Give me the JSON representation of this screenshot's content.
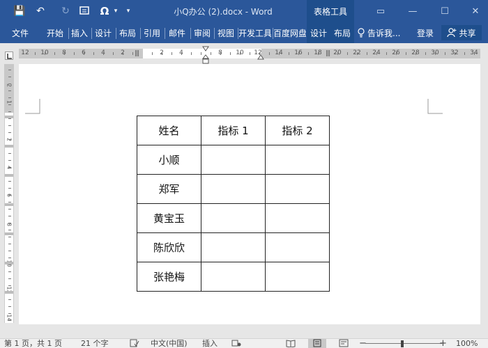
{
  "titlebar": {
    "doc_title": "小Q办公 (2).docx - Word",
    "context_tools": "表格工具",
    "qa": {
      "save": "💾",
      "undo": "↶",
      "redo": "↻",
      "omega": "Ω",
      "more": "▾"
    }
  },
  "window": {
    "restore": "▭",
    "minimize": "—",
    "maximize": "☐",
    "close": "✕"
  },
  "ribbon": {
    "tabs": [
      "文件",
      "开始",
      "插入",
      "设计",
      "布局",
      "引用",
      "邮件",
      "审阅",
      "视图",
      "开发工具",
      "百度网盘"
    ],
    "context_tabs": [
      "设计",
      "布局"
    ],
    "tell_me": "告诉我...",
    "login": "登录",
    "share": "共享"
  },
  "ruler": {
    "labels": [
      "12",
      "10",
      "8",
      "6",
      "4",
      "2",
      "2",
      "4",
      "8",
      "10",
      "12",
      "14",
      "16",
      "18",
      "20",
      "22",
      "24",
      "26",
      "28",
      "30",
      "32",
      "34"
    ],
    "vlabels": [
      "2",
      "1",
      "2",
      "4",
      "6",
      "8",
      "10",
      "12",
      "14"
    ]
  },
  "table": {
    "headers": [
      "姓名",
      "指标 1",
      "指标 2"
    ],
    "rows": [
      [
        "小顺",
        "",
        ""
      ],
      [
        "郑军",
        "",
        ""
      ],
      [
        "黄宝玉",
        "",
        ""
      ],
      [
        "陈欣欣",
        "",
        ""
      ],
      [
        "张艳梅",
        "",
        ""
      ]
    ]
  },
  "status": {
    "page": "第 1 页，共 1 页",
    "words": "21 个字",
    "language": "中文(中国)",
    "mode": "插入",
    "zoom": "100%",
    "zoom_minus": "−",
    "zoom_plus": "+"
  }
}
